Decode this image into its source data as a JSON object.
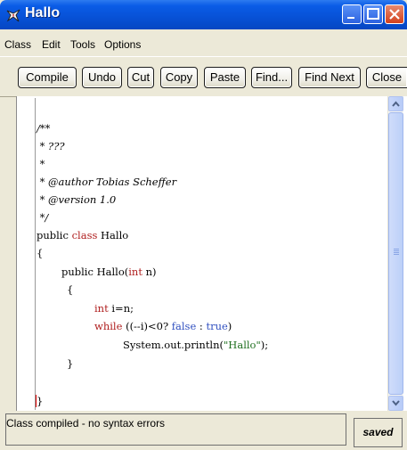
{
  "window": {
    "title": "Hallo"
  },
  "menu": [
    "Class",
    "Edit",
    "Tools",
    "Options"
  ],
  "toolbar": {
    "buttons": [
      "Compile",
      "Undo",
      "Cut",
      "Copy",
      "Paste",
      "Find...",
      "Find Next",
      "Close"
    ]
  },
  "code": {
    "l1": "/**",
    "l2": " * ???",
    "l3": " *",
    "l4": " * @author Tobias Scheffer",
    "l5": " * @version 1.0",
    "l6": " */",
    "l7_kw": "public",
    "l7_kw2": "class",
    "l7_rest": " Hallo",
    "l8": "{",
    "l9_pre": "public Hallo(",
    "l9_kw": "int",
    "l9_post": " n)",
    "l10": "{",
    "l11_kw": "int",
    "l11_rest": " i=n;",
    "l12_kw": "while",
    "l12_mid": " ((--i)<0? ",
    "l12_false": "false",
    "l12_colon": " : ",
    "l12_true": "true",
    "l12_end": ")",
    "l13_pre": "System.out.println(",
    "l13_str": "\"Hallo\"",
    "l13_post": ");",
    "l14": "}",
    "l15": "}"
  },
  "status": {
    "message": "Class compiled - no syntax errors",
    "state": "saved"
  },
  "colors": {
    "keyword": "#b02020",
    "literal": "#3050c0",
    "string": "#207020"
  }
}
